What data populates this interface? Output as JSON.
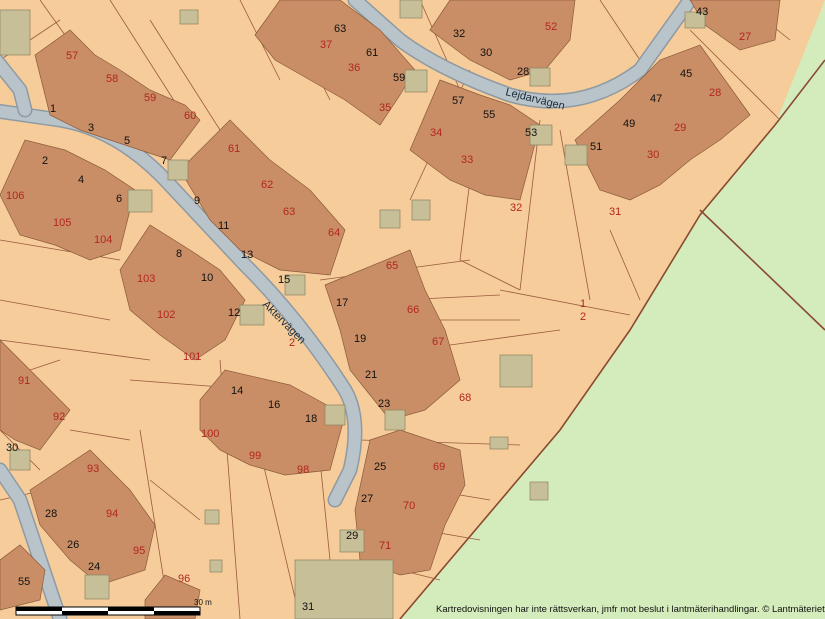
{
  "map": {
    "streets": [
      {
        "name": "Aktervägen"
      },
      {
        "name": "Lejdarvägen"
      }
    ],
    "house_numbers": [
      "63",
      "61",
      "59",
      "57",
      "55",
      "53",
      "51",
      "49",
      "47",
      "45",
      "43",
      "32",
      "30",
      "28",
      "1",
      "3",
      "5",
      "7",
      "2",
      "4",
      "6",
      "9",
      "11",
      "13",
      "15",
      "8",
      "10",
      "12",
      "17",
      "19",
      "21",
      "23",
      "14",
      "16",
      "18",
      "25",
      "27",
      "29",
      "30",
      "28",
      "26",
      "24",
      "31"
    ],
    "property_numbers": [
      "57",
      "58",
      "59",
      "60",
      "37",
      "36",
      "35",
      "52",
      "27",
      "34",
      "33",
      "32",
      "28",
      "29",
      "30",
      "31",
      "61",
      "62",
      "63",
      "64",
      "65",
      "66",
      "67",
      "68",
      "106",
      "105",
      "104",
      "103",
      "102",
      "101",
      "91",
      "92",
      "100",
      "99",
      "98",
      "93",
      "94",
      "95",
      "69",
      "70",
      "71",
      "96",
      "55",
      "2"
    ],
    "parcel_label": {
      "top": "1",
      "bottom": "2"
    },
    "scale": {
      "label": "30 m"
    },
    "disclaimer": "Kartredovisningen har inte rättsverkan, jmfr mot beslut i lantmäterihandlingar. © Lantmäteriet",
    "colors": {
      "land": "#f5cc9a",
      "forest": "#d4ecbc",
      "building": "#c98e65",
      "road": "#b9c3ca",
      "road_edge": "#8e9aa3",
      "boundary": "#8a4a30",
      "outbuilding": "#c7bf98",
      "house_number": "#111111",
      "property_number": "#b3261e"
    }
  }
}
